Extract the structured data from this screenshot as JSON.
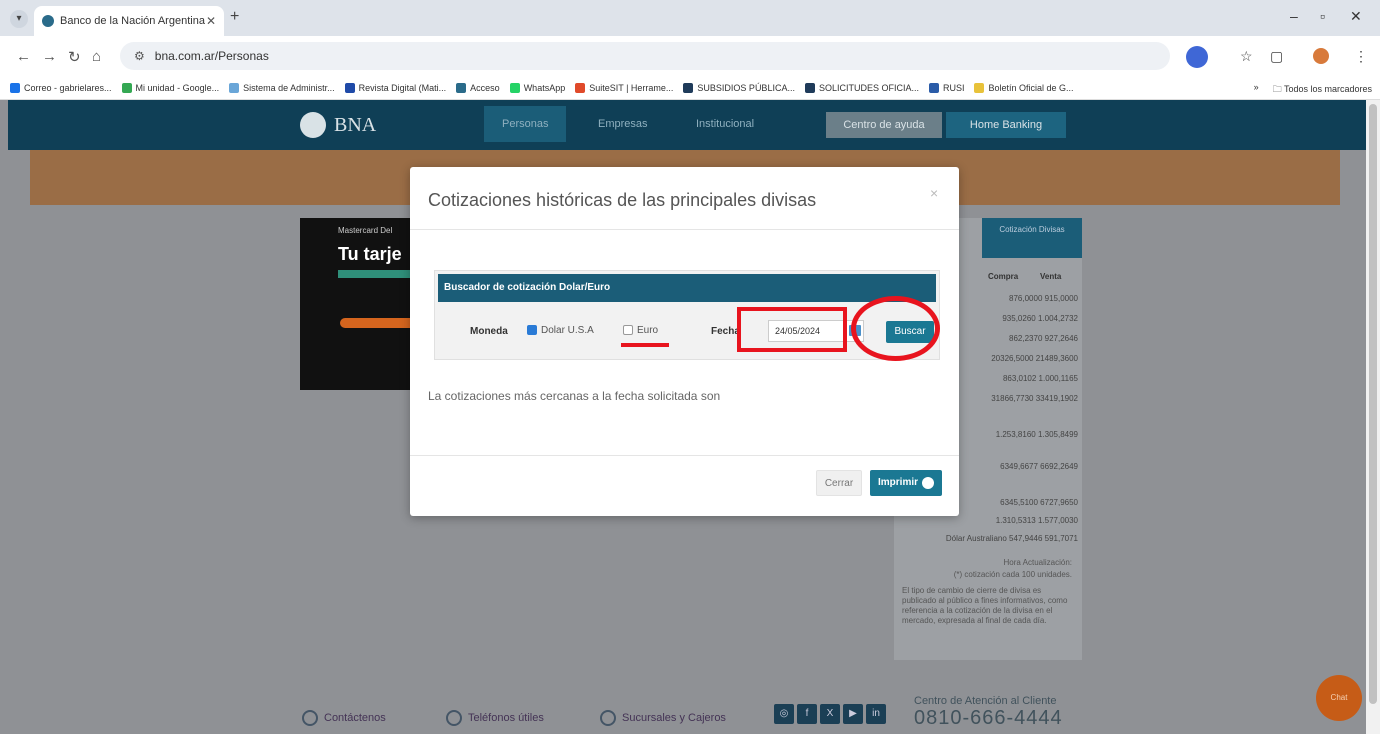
{
  "browser": {
    "tab_title": "Banco de la Nación Argentina",
    "url": "bna.com.ar/Personas",
    "bookmarks": [
      "Correo - gabrielares...",
      "Mi unidad - Google...",
      "Sistema de Administr...",
      "Revista Digital (Mati...",
      "Acceso",
      "WhatsApp",
      "SuiteSIT | Herrame...",
      "SUBSIDIOS PÚBLICA...",
      "SOLICITUDES OFICIA...",
      "RUSI",
      "Boletín Oficial de G..."
    ],
    "bookmarks_more": "»",
    "all_bookmarks": "Todos los marcadores"
  },
  "site": {
    "logo": "BNA",
    "nav": [
      "Personas",
      "Empresas",
      "Institucional"
    ],
    "btn_ayuda": "Centro de ayuda",
    "btn_homebanking": "Home Banking",
    "promo_small": "Mastercard Del",
    "promo_big": "Tu tarje"
  },
  "sidebar": {
    "tab": "Cotización Divisas",
    "col_compra": "Compra",
    "col_venta": "Venta",
    "rows": [
      "876,0000   915,0000",
      "935,0260   1.004,2732",
      "862,2370   927,2646",
      "20326,5000 21489,3600",
      "863,0102   1.000,1165",
      "31866,7730  33419,1902",
      "1.253,8160   1.305,8499",
      "6349,6677   6692,2649",
      "6345,5100   6727,9650",
      "1.310,5313   1.577,0030",
      "Dólar Australiano   547,9446   591,7071"
    ],
    "notes": [
      "Hora Actualización: ",
      "(*) cotización cada 100 unidades.",
      "El tipo de cambio de cierre de divisa es publicado al público a fines informativos, como referencia a la cotización de la divisa en el mercado, expresada al final de cada día."
    ]
  },
  "footer": {
    "items": [
      "Contáctenos",
      "Teléfonos útiles",
      "Sucursales y Cajeros"
    ],
    "centro_label": "Centro de Atención al Cliente",
    "phone": "0810-666-4444",
    "chat": "Chat"
  },
  "modal": {
    "title": "Cotizaciones históricas de las principales divisas",
    "search_header": "Buscador de cotización Dolar/Euro",
    "moneda_label": "Moneda",
    "option_dolar": "Dolar U.S.A",
    "option_euro": "Euro",
    "fecha_label": "Fecha",
    "fecha_value": "24/05/2024",
    "buscar": "Buscar",
    "result_text": "La cotizaciones más cercanas a la fecha solicitada son",
    "cerrar": "Cerrar",
    "imprimir": "Imprimir"
  },
  "colors": {
    "brand": "#0f3f56",
    "accent": "#1b7893",
    "annotation": "#e8141e"
  }
}
